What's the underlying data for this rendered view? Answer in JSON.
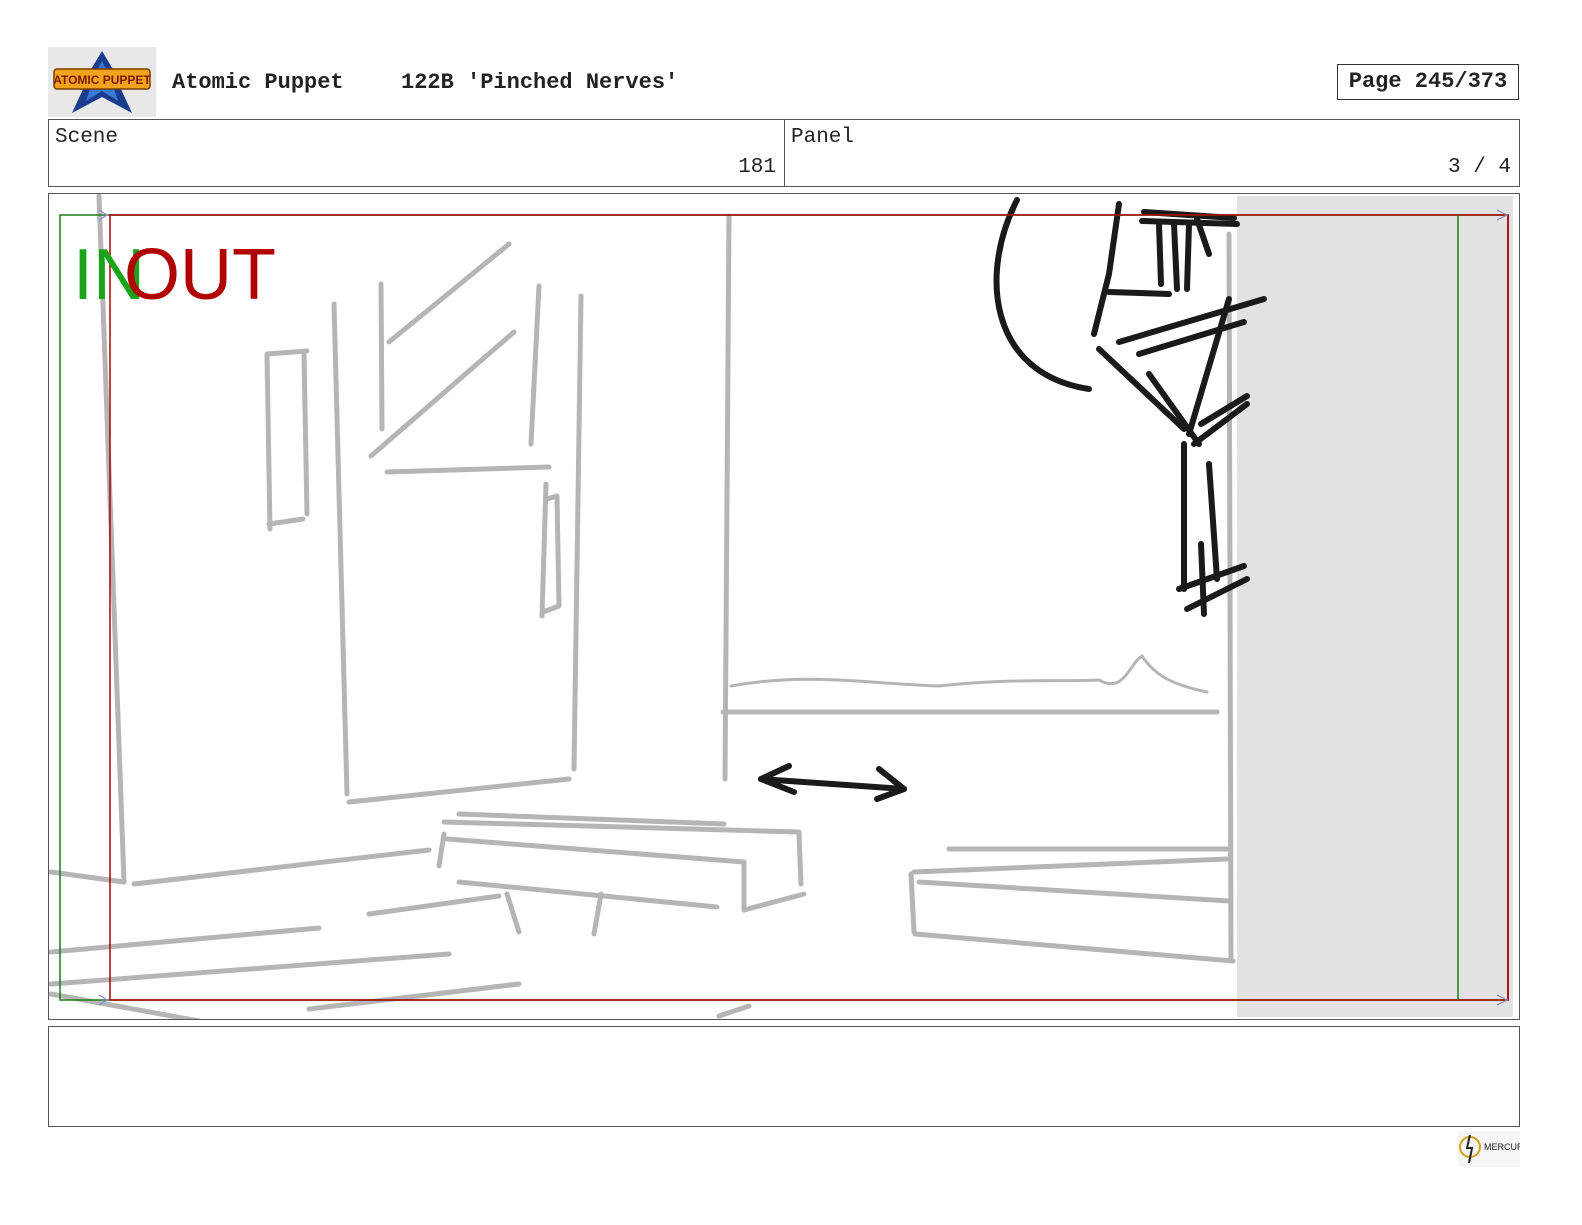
{
  "header": {
    "show": "Atomic Puppet",
    "episode": "122B 'Pinched Nerves'",
    "page": "Page 245/373",
    "logo_text": "ATOMIC PUPPET"
  },
  "scene": {
    "label": "Scene",
    "value": "181"
  },
  "panel": {
    "label": "Panel",
    "value": "3 / 4"
  },
  "frame_markers": {
    "in_label": "IN",
    "out_label": "OUT",
    "in_color": "#1aa31a",
    "out_color": "#b00000"
  },
  "notes": {
    "text": ""
  },
  "footer": {
    "studio_logo_text": "MERCURY"
  }
}
